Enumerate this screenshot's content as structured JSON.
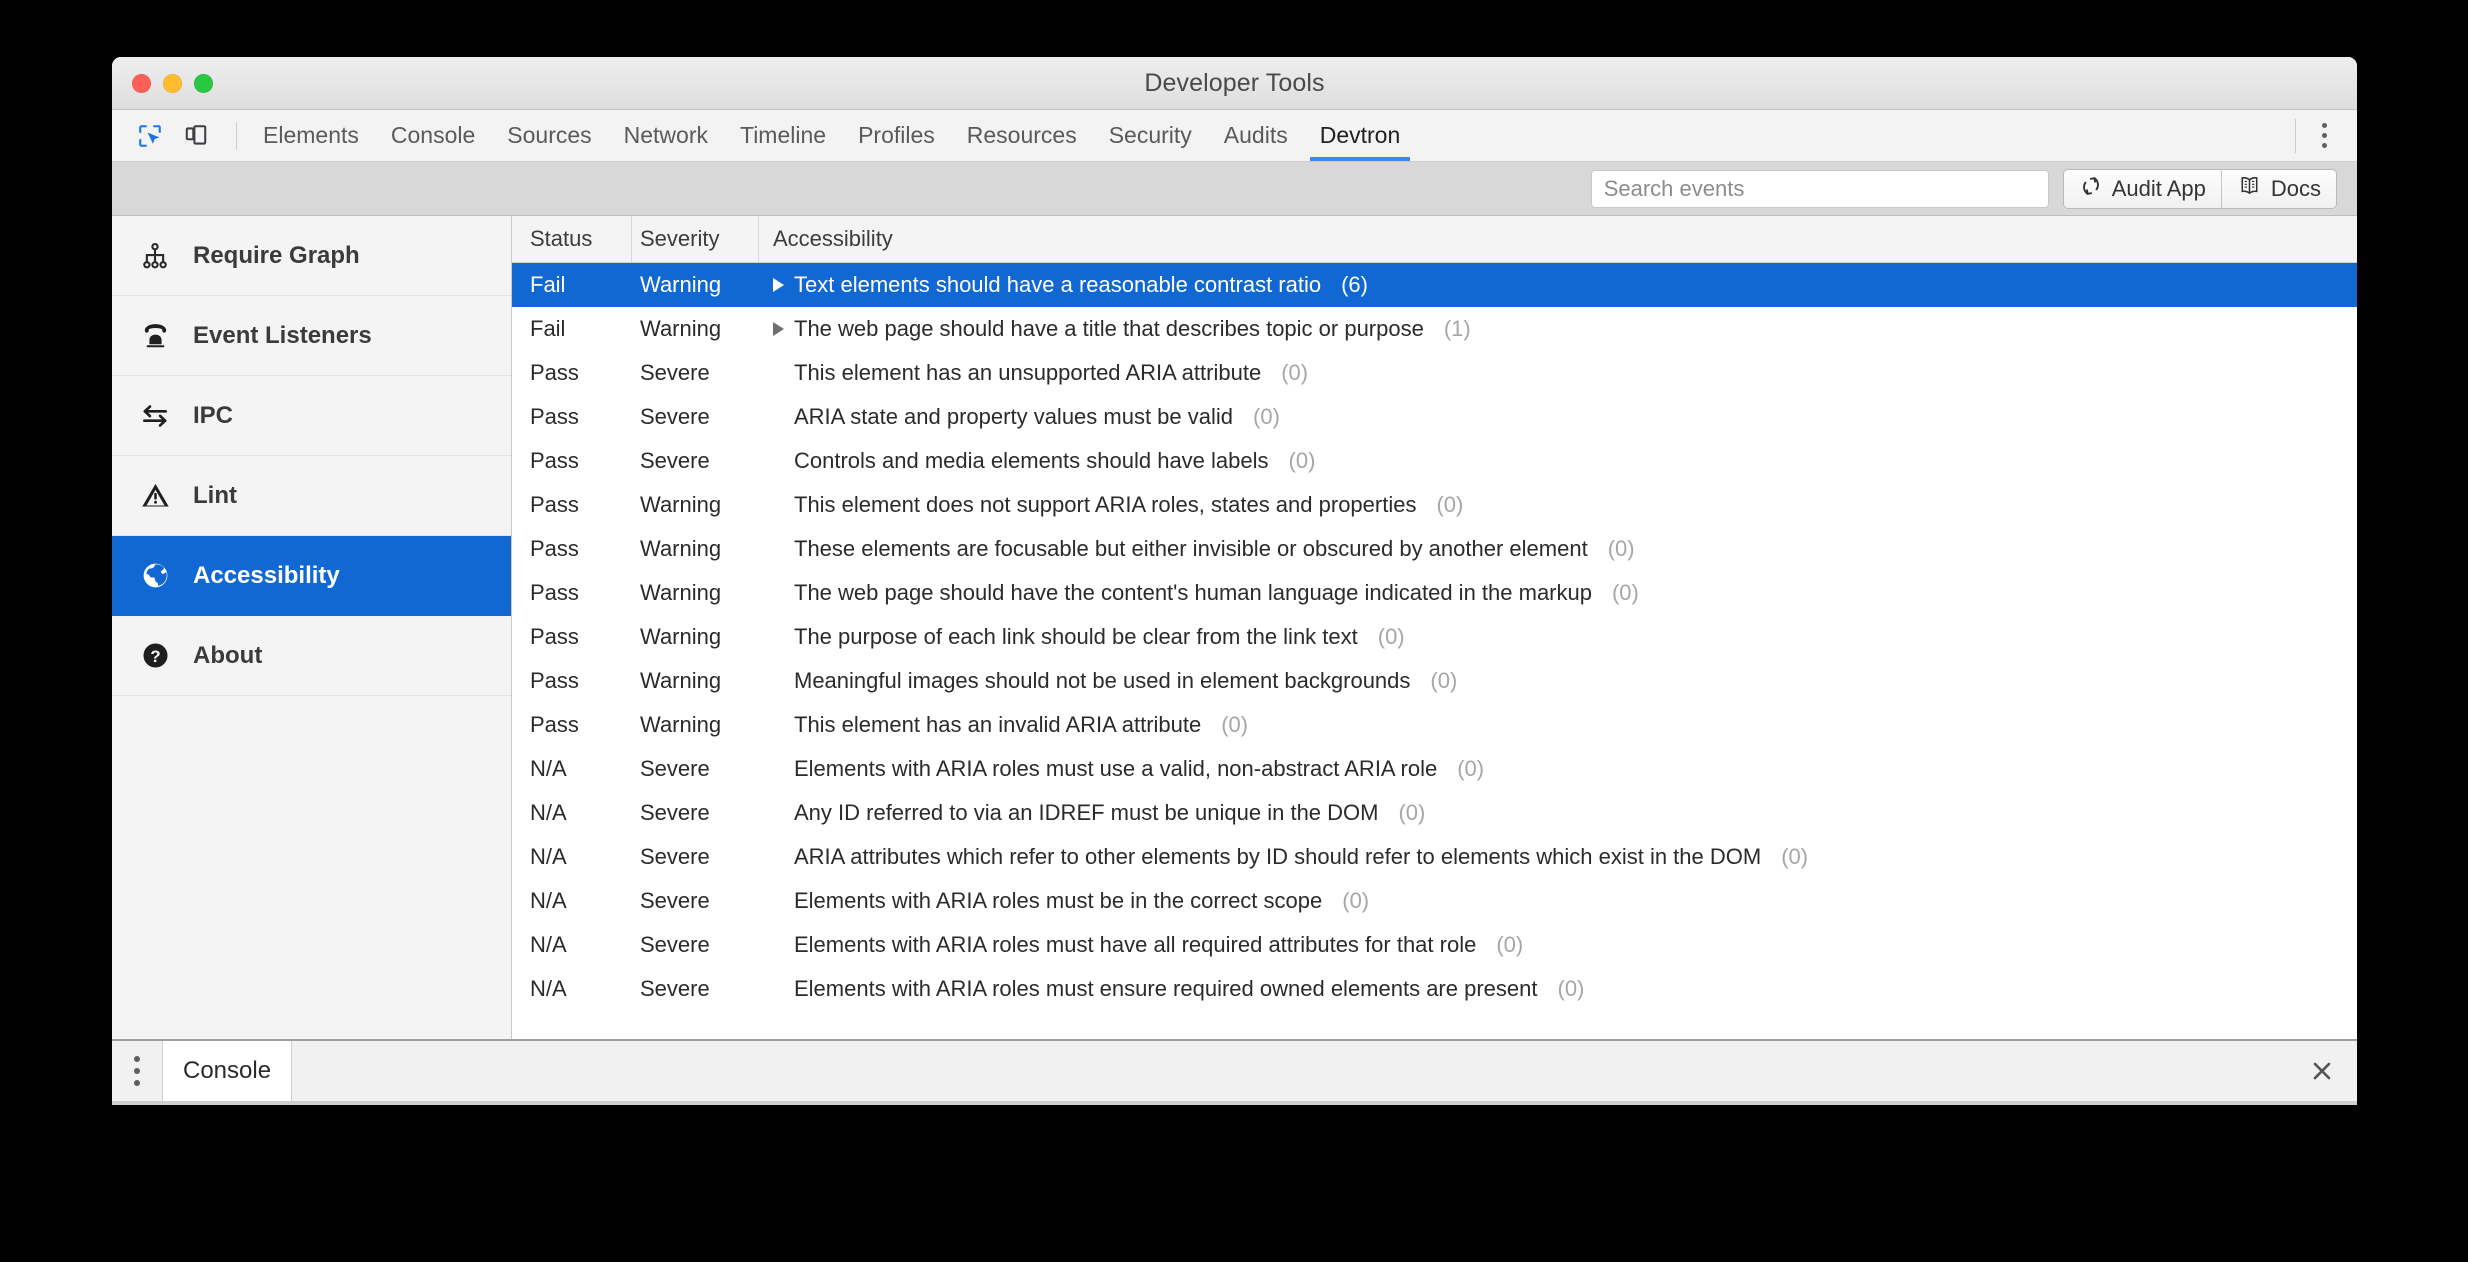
{
  "window": {
    "title": "Developer Tools",
    "traffic_lights": [
      "close-red",
      "minimize-yellow",
      "maximize-green"
    ]
  },
  "devtools_tabs": {
    "items": [
      {
        "label": "Elements",
        "active": false
      },
      {
        "label": "Console",
        "active": false
      },
      {
        "label": "Sources",
        "active": false
      },
      {
        "label": "Network",
        "active": false
      },
      {
        "label": "Timeline",
        "active": false
      },
      {
        "label": "Profiles",
        "active": false
      },
      {
        "label": "Resources",
        "active": false
      },
      {
        "label": "Security",
        "active": false
      },
      {
        "label": "Audits",
        "active": false
      },
      {
        "label": "Devtron",
        "active": true
      }
    ],
    "left_icons": [
      "inspect-element-icon",
      "device-toolbar-icon"
    ],
    "right_icon": "more-options-kebab-icon"
  },
  "devtron_toolbar": {
    "search": {
      "value": "",
      "placeholder": "Search events"
    },
    "audit_button": {
      "label": "Audit App",
      "icon": "refresh-icon"
    },
    "docs_button": {
      "label": "Docs",
      "icon": "book-icon"
    }
  },
  "sidebar": {
    "items": [
      {
        "label": "Require Graph",
        "icon": "sitemap-icon",
        "active": false
      },
      {
        "label": "Event Listeners",
        "icon": "telephone-icon",
        "active": false
      },
      {
        "label": "IPC",
        "icon": "exchange-arrows-icon",
        "active": false
      },
      {
        "label": "Lint",
        "icon": "warning-triangle-icon",
        "active": false
      },
      {
        "label": "Accessibility",
        "icon": "globe-icon",
        "active": true
      },
      {
        "label": "About",
        "icon": "question-circle-icon",
        "active": false
      }
    ]
  },
  "table": {
    "columns": [
      "Status",
      "Severity",
      "Accessibility"
    ],
    "rows": [
      {
        "status": "Fail",
        "severity": "Warning",
        "description": "Text elements should have a reasonable contrast ratio",
        "count": "(6)",
        "expandable": true,
        "selected": true
      },
      {
        "status": "Fail",
        "severity": "Warning",
        "description": "The web page should have a title that describes topic or purpose",
        "count": "(1)",
        "expandable": true,
        "selected": false
      },
      {
        "status": "Pass",
        "severity": "Severe",
        "description": "This element has an unsupported ARIA attribute",
        "count": "(0)",
        "expandable": false,
        "selected": false
      },
      {
        "status": "Pass",
        "severity": "Severe",
        "description": "ARIA state and property values must be valid",
        "count": "(0)",
        "expandable": false,
        "selected": false
      },
      {
        "status": "Pass",
        "severity": "Severe",
        "description": "Controls and media elements should have labels",
        "count": "(0)",
        "expandable": false,
        "selected": false
      },
      {
        "status": "Pass",
        "severity": "Warning",
        "description": "This element does not support ARIA roles, states and properties",
        "count": "(0)",
        "expandable": false,
        "selected": false
      },
      {
        "status": "Pass",
        "severity": "Warning",
        "description": "These elements are focusable but either invisible or obscured by another element",
        "count": "(0)",
        "expandable": false,
        "selected": false
      },
      {
        "status": "Pass",
        "severity": "Warning",
        "description": "The web page should have the content's human language indicated in the markup",
        "count": "(0)",
        "expandable": false,
        "selected": false
      },
      {
        "status": "Pass",
        "severity": "Warning",
        "description": "The purpose of each link should be clear from the link text",
        "count": "(0)",
        "expandable": false,
        "selected": false
      },
      {
        "status": "Pass",
        "severity": "Warning",
        "description": "Meaningful images should not be used in element backgrounds",
        "count": "(0)",
        "expandable": false,
        "selected": false
      },
      {
        "status": "Pass",
        "severity": "Warning",
        "description": "This element has an invalid ARIA attribute",
        "count": "(0)",
        "expandable": false,
        "selected": false
      },
      {
        "status": "N/A",
        "severity": "Severe",
        "description": "Elements with ARIA roles must use a valid, non-abstract ARIA role",
        "count": "(0)",
        "expandable": false,
        "selected": false
      },
      {
        "status": "N/A",
        "severity": "Severe",
        "description": "Any ID referred to via an IDREF must be unique in the DOM",
        "count": "(0)",
        "expandable": false,
        "selected": false
      },
      {
        "status": "N/A",
        "severity": "Severe",
        "description": "ARIA attributes which refer to other elements by ID should refer to elements which exist in the DOM",
        "count": "(0)",
        "expandable": false,
        "selected": false
      },
      {
        "status": "N/A",
        "severity": "Severe",
        "description": "Elements with ARIA roles must be in the correct scope",
        "count": "(0)",
        "expandable": false,
        "selected": false
      },
      {
        "status": "N/A",
        "severity": "Severe",
        "description": "Elements with ARIA roles must have all required attributes for that role",
        "count": "(0)",
        "expandable": false,
        "selected": false
      },
      {
        "status": "N/A",
        "severity": "Severe",
        "description": "Elements with ARIA roles must ensure required owned elements are present",
        "count": "(0)",
        "expandable": false,
        "selected": false
      }
    ]
  },
  "drawer": {
    "tab_label": "Console",
    "close_icon": "close-x-icon",
    "menu_icon": "drawer-kebab-icon"
  },
  "colors": {
    "accent_blue": "#1268d3",
    "tab_underline": "#4285f4",
    "muted_text": "#a6a6a6",
    "window_chrome": "#eeeeee"
  }
}
